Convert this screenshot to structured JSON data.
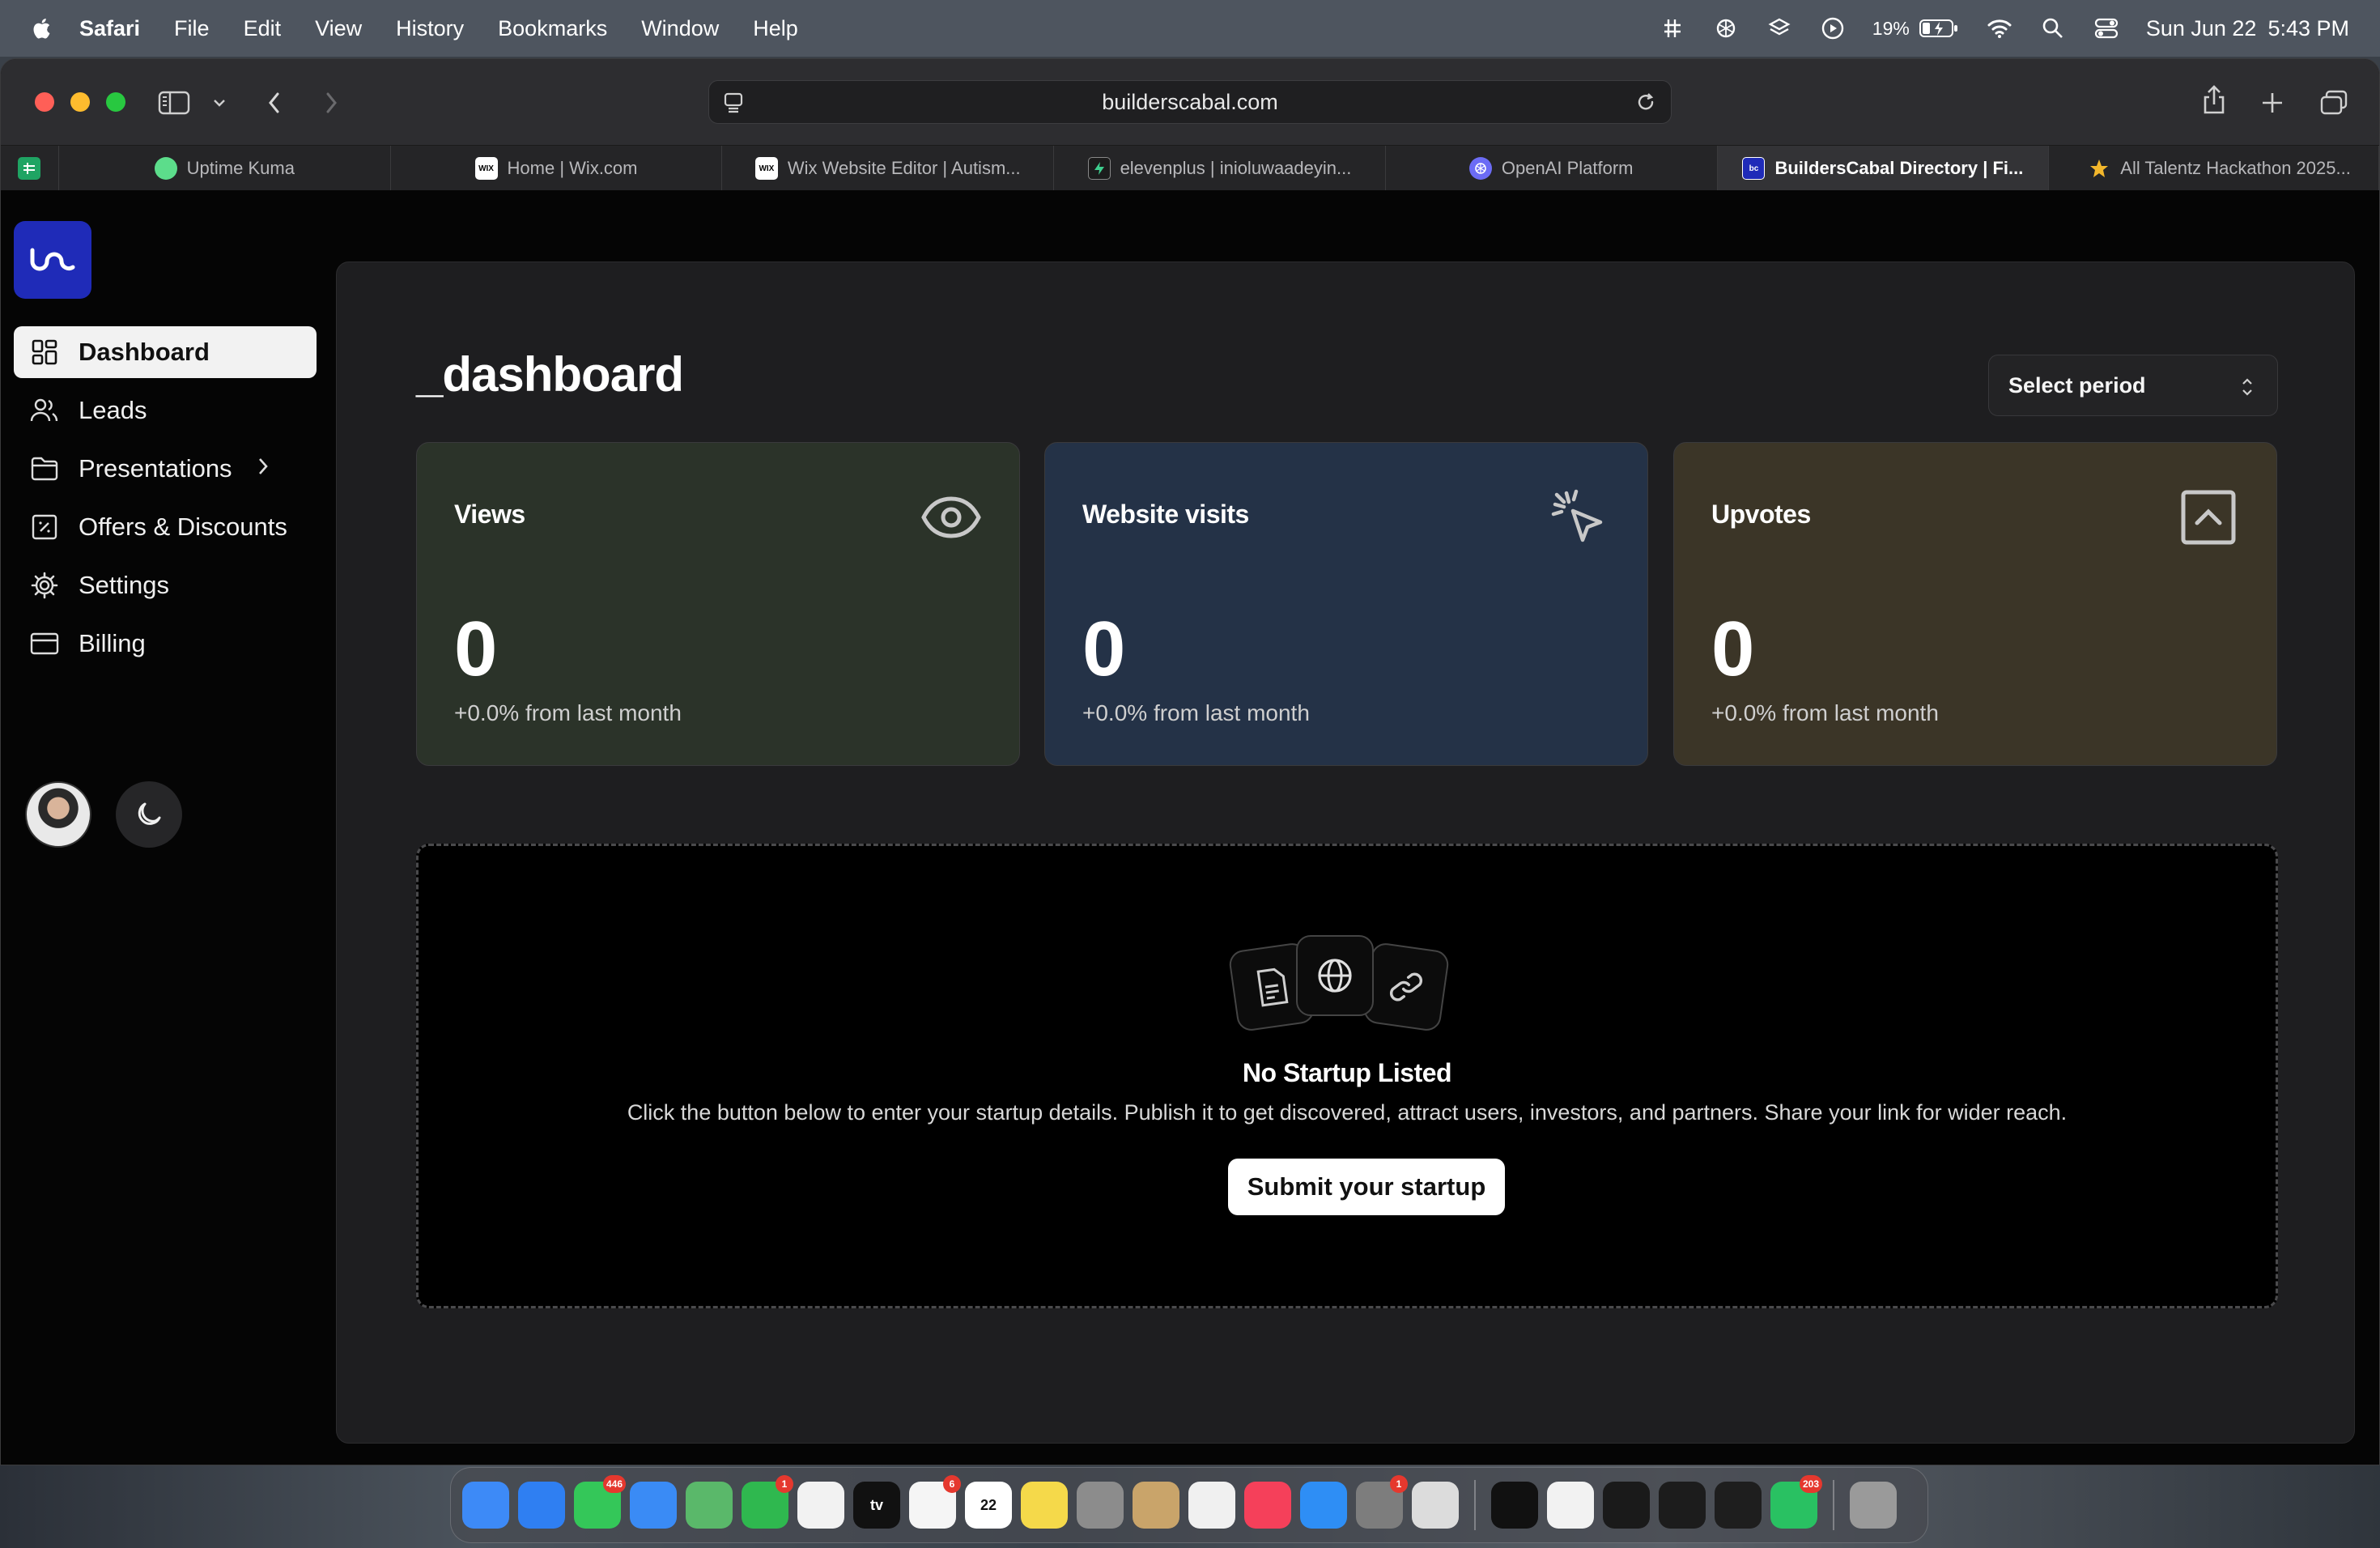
{
  "menubar": {
    "app": "Safari",
    "items": [
      "File",
      "Edit",
      "View",
      "History",
      "Bookmarks",
      "Window",
      "Help"
    ],
    "battery": "19%",
    "date": "Sun Jun 22",
    "time": "5:43 PM"
  },
  "browser": {
    "url": "builderscabal.com",
    "tabs": [
      {
        "label": "Uptime Kuma",
        "favicon": "uptime-kuma-icon"
      },
      {
        "label": "Home | Wix.com",
        "favicon": "wix-icon"
      },
      {
        "label": "Wix Website Editor | Autism...",
        "favicon": "wix-icon"
      },
      {
        "label": "elevenplus | inioluwaadeyin...",
        "favicon": "supabase-icon"
      },
      {
        "label": "OpenAI Platform",
        "favicon": "openai-icon"
      },
      {
        "label": "BuildersCabal Directory | Fi...",
        "favicon": "builderscabal-icon"
      },
      {
        "label": "All Talentz Hackathon 2025...",
        "favicon": "star-icon"
      }
    ]
  },
  "sidebar": {
    "logo_text": "bc",
    "items": [
      {
        "label": "Dashboard",
        "icon": "dashboard-icon"
      },
      {
        "label": "Leads",
        "icon": "users-icon"
      },
      {
        "label": "Presentations",
        "icon": "folder-icon"
      },
      {
        "label": "Offers & Discounts",
        "icon": "percent-icon"
      },
      {
        "label": "Settings",
        "icon": "gear-icon"
      },
      {
        "label": "Billing",
        "icon": "card-icon"
      }
    ]
  },
  "main": {
    "title": "_dashboard",
    "period_select": "Select period",
    "cards": [
      {
        "label": "Views",
        "value": "0",
        "delta": "+0.0% from last month",
        "color": "#2b3329"
      },
      {
        "label": "Website visits",
        "value": "0",
        "delta": "+0.0% from last month",
        "color": "#243247"
      },
      {
        "label": "Upvotes",
        "value": "0",
        "delta": "+0.0% from last month",
        "color": "#3b3527"
      }
    ],
    "empty_state": {
      "title": "No Startup Listed",
      "description": "Click the button below to enter your startup details. Publish it to get discovered, attract users, investors, and partners. Share your link for wider reach.",
      "button": "Submit your startup"
    }
  },
  "dock": {
    "apps": [
      {
        "name": "Finder",
        "color": "#3d8af7"
      },
      {
        "name": "Safari",
        "color": "#2f7ff2"
      },
      {
        "name": "Messages",
        "color": "#34c759",
        "badge": "446"
      },
      {
        "name": "Mail",
        "color": "#3a8bf5"
      },
      {
        "name": "Maps",
        "color": "#5ab86a"
      },
      {
        "name": "FaceTime",
        "color": "#2fb84f",
        "badge": "1"
      },
      {
        "name": "Photos",
        "color": "#f2f2f2"
      },
      {
        "name": "TV",
        "color": "#111111",
        "text": "tv"
      },
      {
        "name": "Reminders",
        "color": "#f5f5f5",
        "badge": "6"
      },
      {
        "name": "Calendar",
        "color": "#ffffff",
        "text": "22"
      },
      {
        "name": "Notes",
        "color": "#f5d94a"
      },
      {
        "name": "Launchpad",
        "color": "#8c8c8c"
      },
      {
        "name": "Contacts",
        "color": "#c9a46a"
      },
      {
        "name": "Freeform",
        "color": "#f0f0f0"
      },
      {
        "name": "Music",
        "color": "#f5405a"
      },
      {
        "name": "App Store",
        "color": "#2e8ef5"
      },
      {
        "name": "System Settings",
        "color": "#7d7d7d",
        "badge": "1"
      },
      {
        "name": "iPhone Mirroring",
        "color": "#dcdcdc"
      },
      {
        "name": "Cursor",
        "color": "#111111"
      },
      {
        "name": "Chrome",
        "color": "#f2f2f2"
      },
      {
        "name": "ChatGPT",
        "color": "#1a1a1a"
      },
      {
        "name": "Terminal",
        "color": "#1c1c1c"
      },
      {
        "name": "Figma",
        "color": "#1e1e1e"
      },
      {
        "name": "WhatsApp",
        "color": "#29c162",
        "badge": "203"
      },
      {
        "name": "Trash",
        "color": "#9a9a9a"
      }
    ]
  }
}
